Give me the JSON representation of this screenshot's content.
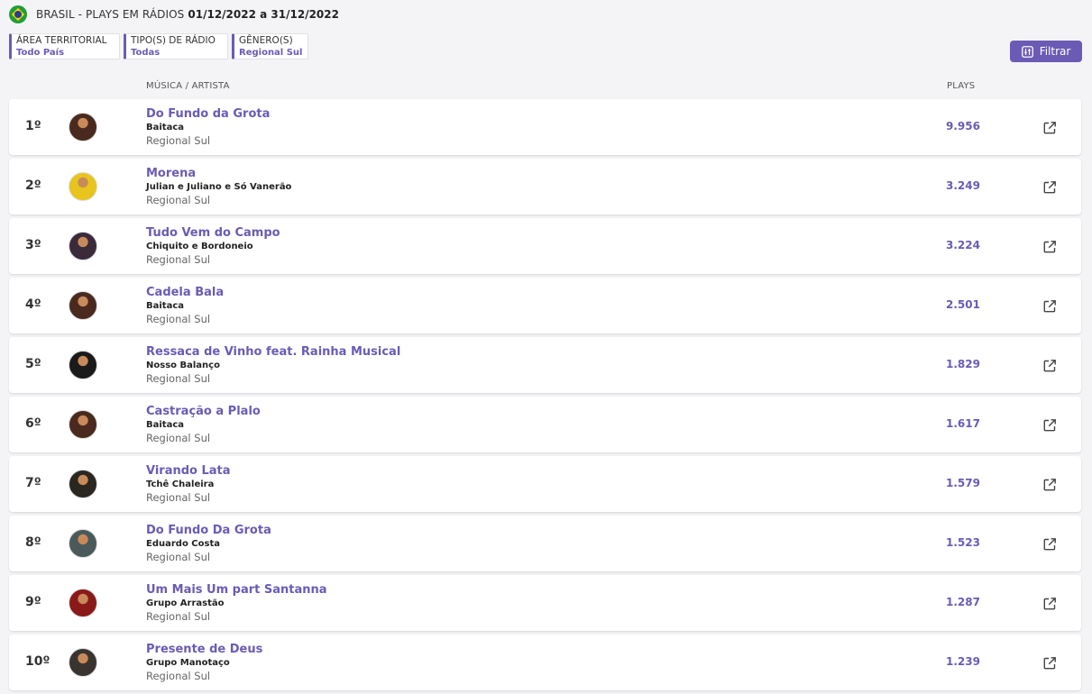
{
  "header": {
    "title": "BRASIL - PLAYS EM RÁDIOS",
    "dates": "01/12/2022 a 31/12/2022"
  },
  "filters": [
    {
      "label": "ÁREA TERRITORIAL",
      "value": "Todo País"
    },
    {
      "label": "TIPO(S) DE RÁDIO",
      "value": "Todas"
    },
    {
      "label": "GÊNERO(S)",
      "value": "Regional Sul"
    }
  ],
  "filter_button": {
    "label": "Filtrar"
  },
  "columns": {
    "music": "MÚSICA / ARTISTA",
    "plays": "PLAYS"
  },
  "rows": [
    {
      "rank": "1º",
      "song": "Do Fundo da Grota",
      "artist": "Baitaca",
      "genre": "Regional Sul",
      "plays": "9.956",
      "avatar_color": "#4a2a1e"
    },
    {
      "rank": "2º",
      "song": "Morena",
      "artist": "Julian e Juliano e Só Vanerão",
      "genre": "Regional Sul",
      "plays": "3.249",
      "avatar_color": "#e8c41c"
    },
    {
      "rank": "3º",
      "song": "Tudo Vem do Campo",
      "artist": "Chiquito e Bordoneio",
      "genre": "Regional Sul",
      "plays": "3.224",
      "avatar_color": "#3a2a3a"
    },
    {
      "rank": "4º",
      "song": "Cadela Bala",
      "artist": "Baitaca",
      "genre": "Regional Sul",
      "plays": "2.501",
      "avatar_color": "#4a2a1e"
    },
    {
      "rank": "5º",
      "song": "Ressaca de Vinho feat. Rainha Musical",
      "artist": "Nosso Balanço",
      "genre": "Regional Sul",
      "plays": "1.829",
      "avatar_color": "#1a1a1a"
    },
    {
      "rank": "6º",
      "song": "Castração a Plalo",
      "artist": "Baitaca",
      "genre": "Regional Sul",
      "plays": "1.617",
      "avatar_color": "#4a2a1e"
    },
    {
      "rank": "7º",
      "song": "Virando Lata",
      "artist": "Tchê Chaleira",
      "genre": "Regional Sul",
      "plays": "1.579",
      "avatar_color": "#2a2620"
    },
    {
      "rank": "8º",
      "song": "Do Fundo Da Grota",
      "artist": "Eduardo Costa",
      "genre": "Regional Sul",
      "plays": "1.523",
      "avatar_color": "#4a5a5a"
    },
    {
      "rank": "9º",
      "song": "Um Mais Um part Santanna",
      "artist": "Grupo Arrastão",
      "genre": "Regional Sul",
      "plays": "1.287",
      "avatar_color": "#8a1a1a"
    },
    {
      "rank": "10º",
      "song": "Presente de Deus",
      "artist": "Grupo Manotaço",
      "genre": "Regional Sul",
      "plays": "1.239",
      "avatar_color": "#3a3430"
    }
  ],
  "icons": {
    "flag": "brazil-flag-icon",
    "filter": "sliders-icon",
    "external": "external-link-icon"
  },
  "colors": {
    "accent": "#6b5bb5",
    "background": "#f4f4f6"
  }
}
